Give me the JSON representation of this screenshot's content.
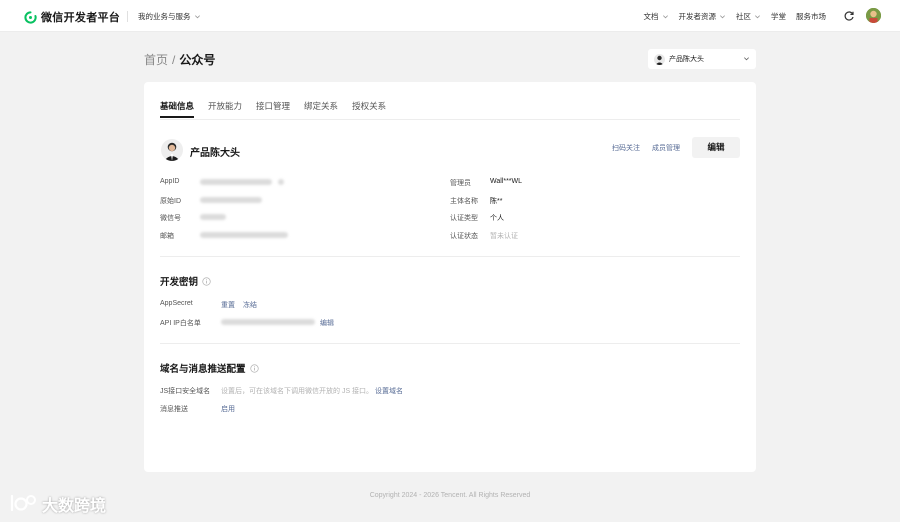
{
  "topbar": {
    "brand": "微信开发者平台",
    "business": "我的业务与服务",
    "nav": [
      {
        "label": "文档",
        "has_menu": true
      },
      {
        "label": "开发者资源",
        "has_menu": true
      },
      {
        "label": "社区",
        "has_menu": true
      },
      {
        "label": "学堂",
        "has_menu": false
      },
      {
        "label": "服务市场",
        "has_menu": false
      }
    ],
    "brand_color": "#07c160"
  },
  "breadcrumb": {
    "home": "首页",
    "separator": "/",
    "current": "公众号"
  },
  "account_select": {
    "value": "产品陈大头"
  },
  "tabs": [
    {
      "label": "基础信息",
      "active": true
    },
    {
      "label": "开放能力",
      "active": false
    },
    {
      "label": "接口管理",
      "active": false
    },
    {
      "label": "绑定关系",
      "active": false
    },
    {
      "label": "授权关系",
      "active": false
    }
  ],
  "account": {
    "name": "产品陈大头",
    "scan_follow": "扫码关注",
    "member_manage": "成员管理",
    "edit_label": "编辑"
  },
  "basic_info": {
    "left": [
      {
        "label": "AppID"
      },
      {
        "label": "原始ID"
      },
      {
        "label": "微信号"
      },
      {
        "label": "邮箱"
      }
    ],
    "right": [
      {
        "label": "管理员",
        "value": "Wall***WL"
      },
      {
        "label": "主体名称",
        "value": "陈**"
      },
      {
        "label": "认证类型",
        "value": "个人"
      },
      {
        "label": "认证状态",
        "value": "暂未认证"
      }
    ]
  },
  "dev_key": {
    "title": "开发密钥",
    "appsecret_label": "AppSecret",
    "reset": "重置",
    "freeze": "冻结",
    "whitelist_label": "API IP白名单",
    "whitelist_edit": "编辑"
  },
  "domain_config": {
    "title": "域名与消息推送配置",
    "js_label": "JS接口安全域名",
    "js_desc": "设置后，可在该域名下调用微信开放的 JS 接口。",
    "js_link": "设置域名",
    "push_label": "消息推送",
    "push_link": "启用"
  },
  "footer": "Copyright 2024 - 2026 Tencent. All Rights Reserved",
  "watermark": "大数跨境",
  "colors": {
    "link": "#576b95",
    "background": "#f2f2f2"
  }
}
